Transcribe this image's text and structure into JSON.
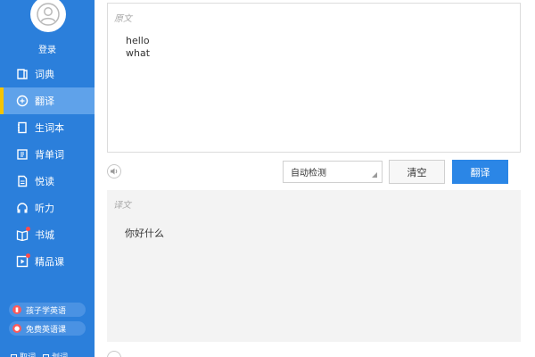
{
  "sidebar": {
    "login_label": "登录",
    "items": [
      {
        "label": "词典",
        "icon": "book-icon",
        "active": false,
        "dot": false
      },
      {
        "label": "翻译",
        "icon": "translate-icon",
        "active": true,
        "dot": false
      },
      {
        "label": "生词本",
        "icon": "notebook-icon",
        "active": false,
        "dot": false
      },
      {
        "label": "背单词",
        "icon": "card-icon",
        "active": false,
        "dot": false
      },
      {
        "label": "悦读",
        "icon": "document-icon",
        "active": false,
        "dot": false
      },
      {
        "label": "听力",
        "icon": "headphones-icon",
        "active": false,
        "dot": false
      },
      {
        "label": "书城",
        "icon": "bookstore-icon",
        "active": false,
        "dot": true
      },
      {
        "label": "精品课",
        "icon": "play-icon",
        "active": false,
        "dot": true
      }
    ],
    "promos": [
      {
        "label": "孩子学英语",
        "color": "#ff5a5a"
      },
      {
        "label": "免费英语课",
        "color": "#ff5a5a"
      }
    ],
    "bottom_links": [
      "取词",
      "划词"
    ]
  },
  "source": {
    "label": "原文",
    "lines": [
      "hello",
      "what"
    ]
  },
  "toolbar": {
    "language_select": "自动检测",
    "clear_label": "清空",
    "translate_label": "翻译"
  },
  "result": {
    "label": "译文",
    "text": "你好什么"
  },
  "colors": {
    "sidebar_bg": "#2b7fdb",
    "active_item": "#5fa2ea",
    "active_marker": "#f5c400",
    "primary_button": "#2b86e6"
  }
}
